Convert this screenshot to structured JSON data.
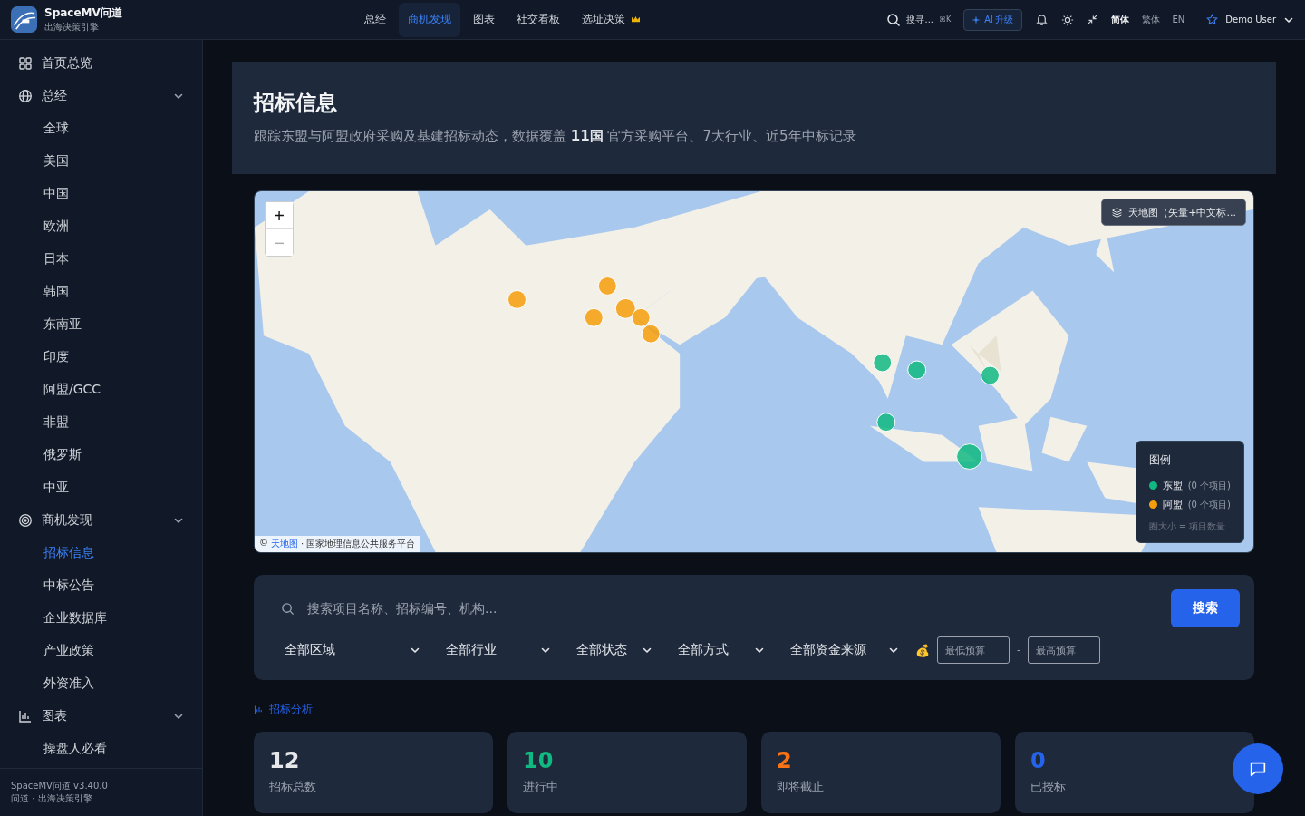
{
  "brand": {
    "name": "SpaceMV问道",
    "tagline": "出海决策引擎"
  },
  "nav": [
    {
      "label": "总经",
      "selected": false
    },
    {
      "label": "商机发现",
      "selected": true
    },
    {
      "label": "图表",
      "selected": false
    },
    {
      "label": "社交看板",
      "selected": false
    },
    {
      "label": "选址决策",
      "selected": false,
      "premium": true
    }
  ],
  "topbar": {
    "search": "搜寻...",
    "shortcut": "⌘K",
    "ai_button": "AI 升级",
    "languages": [
      {
        "label": "简体",
        "selected": true
      },
      {
        "label": "繁体",
        "selected": false
      },
      {
        "label": "EN",
        "selected": false
      }
    ],
    "user": "Demo User"
  },
  "sidebar": {
    "items": [
      {
        "kind": "link",
        "label": "首页总览"
      },
      {
        "kind": "group",
        "label": "总经",
        "expanded": true,
        "children": [
          {
            "label": "全球",
            "selected": false
          },
          {
            "label": "美国",
            "selected": false
          },
          {
            "label": "中国",
            "selected": false
          },
          {
            "label": "欧洲",
            "selected": false
          },
          {
            "label": "日本",
            "selected": false
          },
          {
            "label": "韩国",
            "selected": false
          },
          {
            "label": "东南亚",
            "selected": false
          },
          {
            "label": "印度",
            "selected": false
          },
          {
            "label": "阿盟/GCC",
            "selected": false
          },
          {
            "label": "非盟",
            "selected": false
          },
          {
            "label": "俄罗斯",
            "selected": false
          },
          {
            "label": "中亚",
            "selected": false
          }
        ]
      },
      {
        "kind": "group",
        "label": "商机发现",
        "expanded": true,
        "children": [
          {
            "label": "招标信息",
            "selected": true
          },
          {
            "label": "中标公告",
            "selected": false
          },
          {
            "label": "企业数据库",
            "selected": false
          },
          {
            "label": "产业政策",
            "selected": false
          },
          {
            "label": "外资准入",
            "selected": false
          }
        ]
      },
      {
        "kind": "group",
        "label": "图表",
        "expanded": true,
        "children": [
          {
            "label": "操盘人必看",
            "selected": false
          }
        ]
      }
    ],
    "version": "SpaceMV问道 v3.40.0",
    "footer": "问道 · 出海决策引擎"
  },
  "header": {
    "title": "招标信息",
    "subtitle": "跟踪东盟与阿盟政府采购及基建招标动态，数据覆盖 **11国** 官方采购平台、7大行业、近5年中标记录"
  },
  "map": {
    "layer_button": "天地图（矢量+中文标...",
    "copyright": "©",
    "attribution_link": "天地图",
    "attribution": "· 国家地理信息公共服务平台",
    "zoom_in": "+",
    "zoom_out": "−",
    "legend": {
      "title": "图例",
      "items": [
        {
          "label": "东盟",
          "count": "(0 个项目)",
          "color": "#10b981"
        },
        {
          "label": "阿盟",
          "count": "(0 个项目)",
          "color": "#f59e0b"
        }
      ],
      "note": "圈大小 = 项目数量"
    }
  },
  "filters": {
    "search_placeholder": "搜索项目名称、招标编号、机构...",
    "search_button": "搜索",
    "selects": [
      "全部区域",
      "全部行业",
      "全部状态",
      "全部方式",
      "全部资金来源"
    ],
    "budget_icon": "💰",
    "budget_min_placeholder": "最低预算",
    "budget_separator": "-",
    "budget_max_placeholder": "最高预算"
  },
  "analysis_link": "招标分析",
  "stats": [
    {
      "value": "12",
      "label": "招标总数",
      "color": "#e5e7eb"
    },
    {
      "value": "10",
      "label": "进行中",
      "color": "#10b981"
    },
    {
      "value": "2",
      "label": "即将截止",
      "color": "#f97316"
    },
    {
      "value": "0",
      "label": "已授标",
      "color": "#2563eb"
    }
  ]
}
